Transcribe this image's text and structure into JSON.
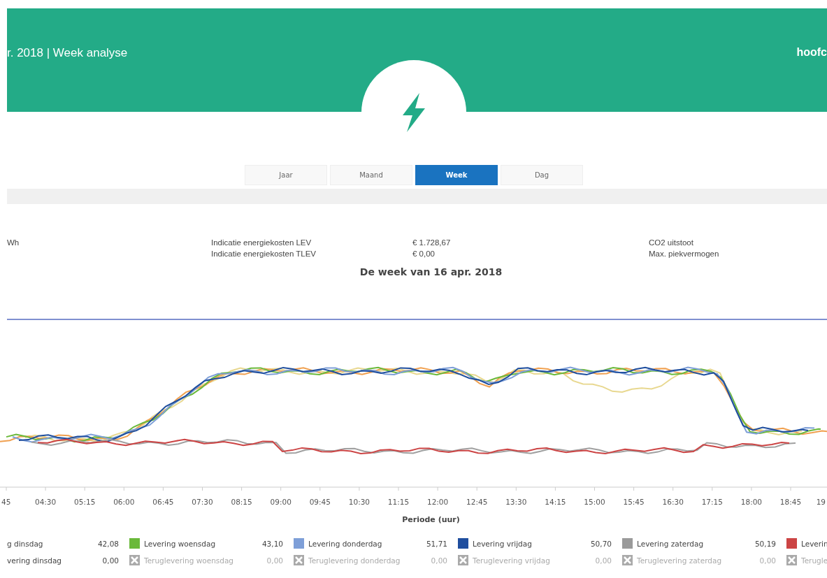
{
  "header": {
    "title": "r. 2018 | Week analyse",
    "user": "hoofc"
  },
  "tabs": [
    {
      "label": "Jaar",
      "selected": false
    },
    {
      "label": "Maand",
      "selected": false
    },
    {
      "label": "Week",
      "selected": true
    },
    {
      "label": "Dag",
      "selected": false
    }
  ],
  "stats": {
    "lead": "Wh",
    "rows": [
      {
        "label": "Indicatie energiekosten LEV",
        "value": "€ 1.728,67",
        "right_label": "CO2 uitstoot"
      },
      {
        "label": "Indicatie energiekosten TLEV",
        "value": "€ 0,00",
        "right_label": "Max. piekvermogen"
      }
    ]
  },
  "chart": {
    "title": "De week van 16 apr. 2018",
    "xlabel": "Periode (uur)",
    "x_labels": [
      "45",
      "04:30",
      "05:15",
      "06:00",
      "06:45",
      "07:30",
      "08:15",
      "09:00",
      "09:45",
      "10:30",
      "11:15",
      "12:00",
      "12:45",
      "13:30",
      "14:15",
      "15:00",
      "15:45",
      "16:30",
      "17:15",
      "18:00",
      "18:45",
      "19"
    ]
  },
  "legend": [
    {
      "items": [
        {
          "label": "g dinsdag",
          "value": "42,08"
        },
        {
          "label": "Levering woensdag",
          "value": "43,10",
          "color": "#6ab93a",
          "hidden": false
        },
        {
          "label": "Levering donderdag",
          "value": "51,71",
          "color": "#7e9fd8",
          "hidden": false
        },
        {
          "label": "Levering vrijdag",
          "value": "50,70",
          "color": "#1f4e9e",
          "hidden": false
        },
        {
          "label": "Levering zaterdag",
          "value": "50,19",
          "color": "#9a9a9a",
          "hidden": false
        },
        {
          "label": "Leverin",
          "color": "#cc4444",
          "hidden": false
        }
      ]
    },
    {
      "items": [
        {
          "label": "vering dinsdag",
          "value": "0,00"
        },
        {
          "label": "Teruglevering woensdag",
          "value": "0,00",
          "color": "#aaaaaa",
          "hidden": true
        },
        {
          "label": "Teruglevering donderdag",
          "value": "0,00",
          "color": "#aaaaaa",
          "hidden": true
        },
        {
          "label": "Teruglevering vrijdag",
          "value": "0,00",
          "color": "#aaaaaa",
          "hidden": true
        },
        {
          "label": "Teruglevering zaterdag",
          "value": "0,00",
          "color": "#aaaaaa",
          "hidden": true
        },
        {
          "label": "Terugle",
          "color": "#aaaaaa",
          "hidden": true
        }
      ]
    }
  ]
}
